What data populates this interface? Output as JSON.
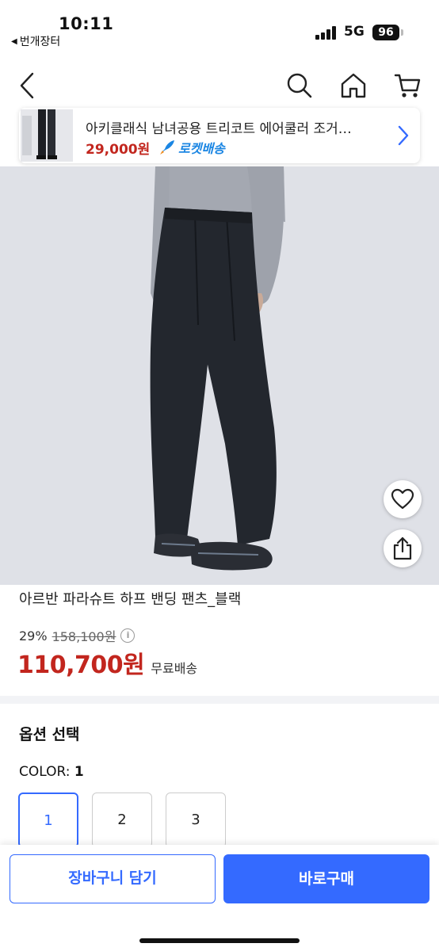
{
  "status_bar": {
    "time": "10:11",
    "back_app": "번개장터",
    "network": "5G",
    "battery": "96"
  },
  "nav": {
    "icons": [
      "back-icon",
      "search-icon",
      "home-icon",
      "cart-icon"
    ]
  },
  "banner": {
    "title": "아키클래식 남녀공용 트리코트 에어쿨러 조거…",
    "price": "29,000원",
    "delivery_badge": "로켓배송"
  },
  "product": {
    "name": "아르반 파라슈트 하프 밴딩 팬츠_블랙",
    "discount_rate": "29%",
    "original_price": "158,100원",
    "sale_price": "110,700원",
    "shipping": "무료배송"
  },
  "options": {
    "title": "옵션 선택",
    "color_label": "COLOR:",
    "selected_value": "1",
    "items": [
      "1",
      "2",
      "3"
    ]
  },
  "actions": {
    "cart_label": "장바구니 담기",
    "buy_label": "바로구매"
  },
  "colors": {
    "accent": "#346aff",
    "price": "#c2261e",
    "rocket": "#1b86e3"
  }
}
